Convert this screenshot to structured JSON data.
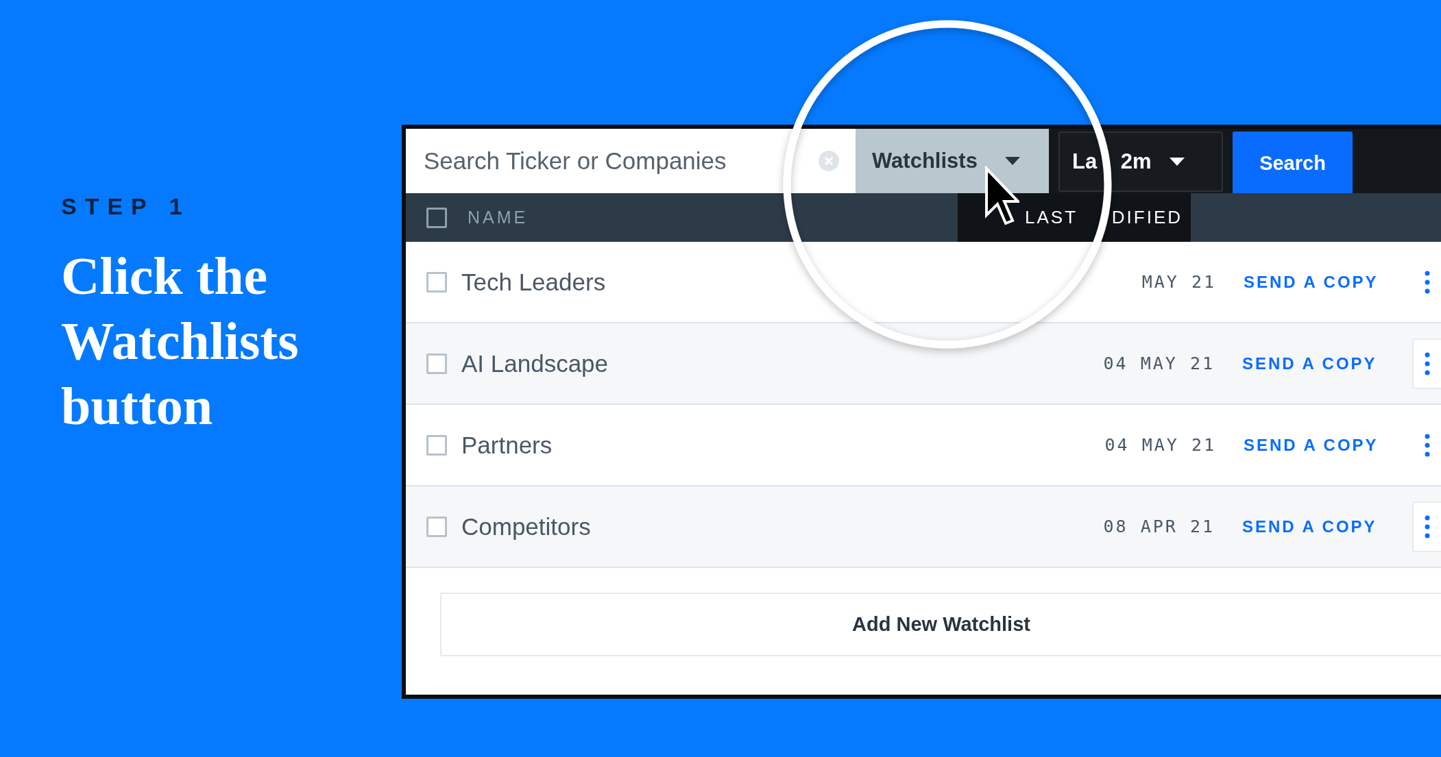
{
  "step_label": "STEP 1",
  "heading": "Click the Watchlists button",
  "toolbar": {
    "search": {
      "placeholder": "Search Ticker or Companies"
    },
    "watchlists_button": "Watchlists",
    "range_dropdown": "La 2m",
    "search_button": "Search"
  },
  "table": {
    "select_all": {
      "checked": false
    },
    "columns": [
      "NAME",
      "LAST DIFIED"
    ],
    "rows": [
      {
        "name": "Tech Leaders",
        "date": "MAY 21",
        "action": "SEND A COPY",
        "checked": false
      },
      {
        "name": "AI Landscape",
        "date": "04 MAY 21",
        "action": "SEND A COPY",
        "checked": false
      },
      {
        "name": "Partners",
        "date": "04 MAY 21",
        "action": "SEND A COPY",
        "checked": false
      },
      {
        "name": "Competitors",
        "date": "08 APR 21",
        "action": "SEND A COPY",
        "checked": false
      }
    ]
  },
  "add_button": "Add New Watchlist"
}
